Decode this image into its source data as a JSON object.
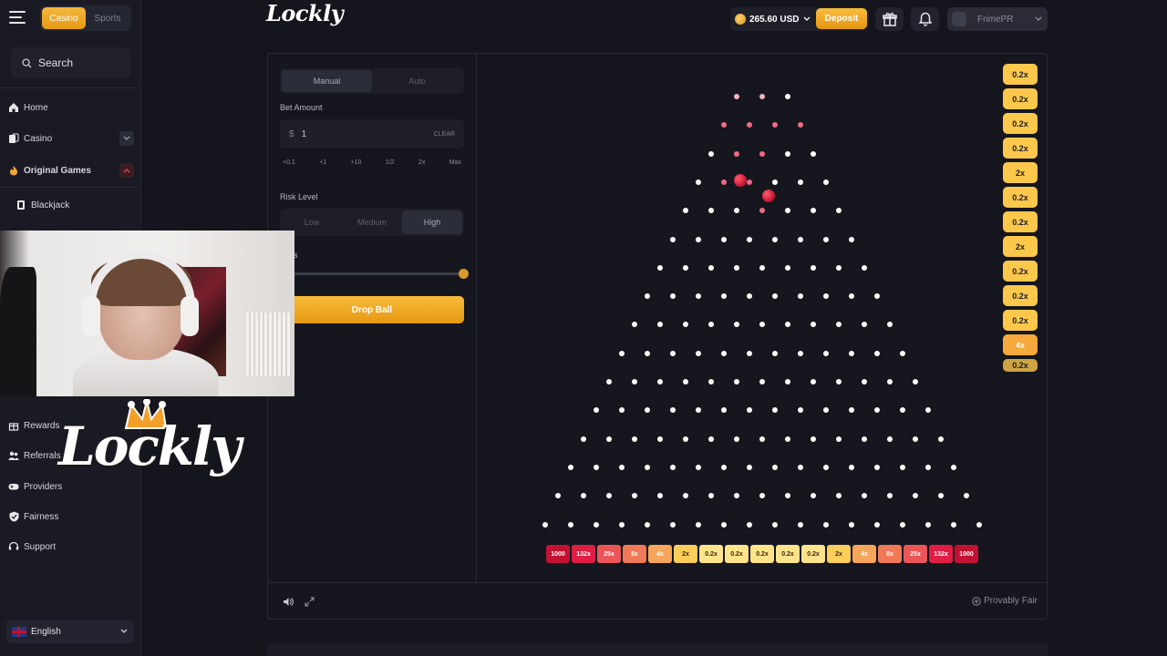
{
  "sidebar": {
    "toggle": {
      "casino": "Casino",
      "sports": "Sports"
    },
    "search_label": "Search",
    "items": [
      {
        "label": "Home",
        "icon": "home-icon"
      },
      {
        "label": "Casino",
        "icon": "cards-icon"
      },
      {
        "label": "Original Games",
        "icon": "fire-icon"
      },
      {
        "label": "Blackjack",
        "icon": "blackjack-icon"
      },
      {
        "label": "Rewards",
        "icon": "gift-icon"
      },
      {
        "label": "Referrals",
        "icon": "users-icon"
      },
      {
        "label": "Providers",
        "icon": "gamepad-icon"
      },
      {
        "label": "Fairness",
        "icon": "shield-icon"
      },
      {
        "label": "Support",
        "icon": "headset-icon"
      }
    ],
    "language": "English"
  },
  "header": {
    "logo": "Lockly",
    "balance": "265.60 USD",
    "deposit_label": "Deposit",
    "username": "FrimePR"
  },
  "controls": {
    "tabs": {
      "manual": "Manual",
      "auto": "Auto"
    },
    "bet_label": "Bet Amount",
    "currency_symbol": "$",
    "bet_value": "1",
    "clear_label": "CLEAR",
    "quick": [
      "+0.1",
      "+1",
      "+10",
      "1/2",
      "2x",
      "Max"
    ],
    "risk_label": "Risk Level",
    "risk": {
      "low": "Low",
      "medium": "Medium",
      "high": "High"
    },
    "rows_fragment": "s",
    "drop_label": "Drop Ball"
  },
  "game": {
    "rows": 16,
    "peg_colors": {
      "active": "#f06a86",
      "normal": "#ffffff"
    },
    "buckets": [
      "1000",
      "132x",
      "25x",
      "8x",
      "4x",
      "2x",
      "0.2x",
      "0.2x",
      "0.2x",
      "0.2x",
      "0.2x",
      "2x",
      "4x",
      "8x",
      "25x",
      "132x",
      "1000"
    ],
    "history": [
      "0.2x",
      "0.2x",
      "0.2x",
      "0.2x",
      "2x",
      "0.2x",
      "0.2x",
      "2x",
      "0.2x",
      "0.2x",
      "0.2x",
      "4x",
      "0.2x"
    ],
    "provably_fair": "Provably Fair"
  },
  "overlay": {
    "logo_text": "Lockly"
  },
  "colors": {
    "accent": "#f5b23a",
    "sidebar_bg": "#191a23",
    "page_bg": "#14151d"
  }
}
